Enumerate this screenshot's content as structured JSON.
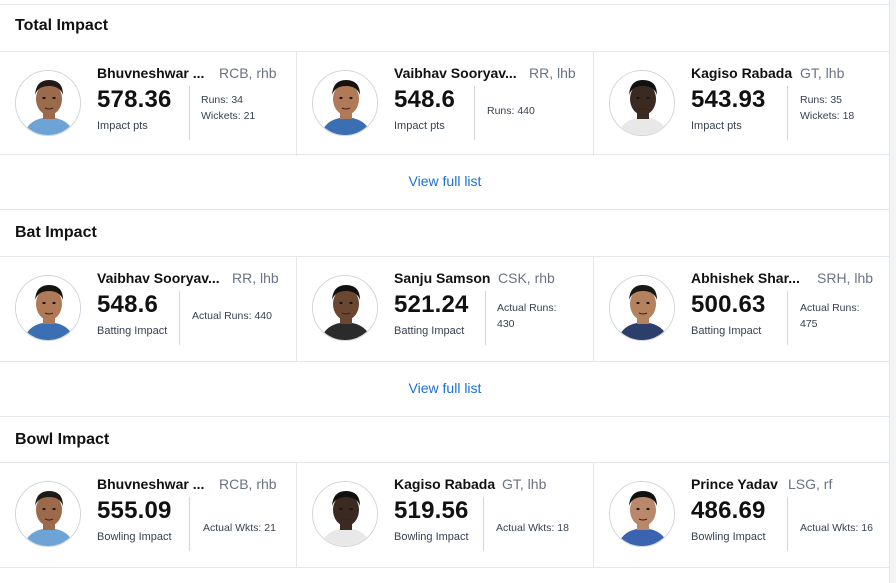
{
  "sections": [
    {
      "title": "Total Impact",
      "view_label": "View full list",
      "cards": [
        {
          "name": "Bhuvneshwar ...",
          "team": "RCB, rhb",
          "score": "578.36",
          "label": "Impact pts",
          "stats": [
            "Runs: 34",
            "Wickets: 21"
          ],
          "skin": "#9a6a4a",
          "hair": "#1f1a17",
          "jersey": "#6ea3d6"
        },
        {
          "name": "Vaibhav Sooryav...",
          "team": "RR, lhb",
          "score": "548.6",
          "label": "Impact pts",
          "stats": [
            "Runs: 440"
          ],
          "skin": "#b07a58",
          "hair": "#16130f",
          "jersey": "#3a6fb3"
        },
        {
          "name": "Kagiso Rabada",
          "team": "GT, lhb",
          "score": "543.93",
          "label": "Impact pts",
          "stats": [
            "Runs: 35",
            "Wickets: 18"
          ],
          "skin": "#3b2a22",
          "hair": "#111111",
          "jersey": "#e8e8e8"
        }
      ]
    },
    {
      "title": "Bat Impact",
      "view_label": "View full list",
      "cards": [
        {
          "name": "Vaibhav Sooryav...",
          "team": "RR, lhb",
          "score": "548.6",
          "label": "Batting Impact",
          "stats": [
            "Actual Runs: 440"
          ],
          "skin": "#b07a58",
          "hair": "#16130f",
          "jersey": "#3a6fb3"
        },
        {
          "name": "Sanju Samson",
          "team": "CSK, rhb",
          "score": "521.24",
          "label": "Batting Impact",
          "stats": [
            "Actual Runs:",
            "430"
          ],
          "skin": "#6b4630",
          "hair": "#121010",
          "jersey": "#2b2b2b"
        },
        {
          "name": "Abhishek Shar...",
          "team": "SRH, lhb",
          "score": "500.63",
          "label": "Batting Impact",
          "stats": [
            "Actual Runs:",
            "475"
          ],
          "skin": "#b58260",
          "hair": "#1a1714",
          "jersey": "#2c3e6a"
        }
      ]
    },
    {
      "title": "Bowl Impact",
      "cards": [
        {
          "name": "Bhuvneshwar ...",
          "team": "RCB, rhb",
          "score": "555.09",
          "label": "Bowling Impact",
          "stats": [
            "Actual Wkts: 21"
          ],
          "skin": "#9a6a4a",
          "hair": "#1f1a17",
          "jersey": "#6ea3d6"
        },
        {
          "name": "Kagiso Rabada",
          "team": "GT, lhb",
          "score": "519.56",
          "label": "Bowling Impact",
          "stats": [
            "Actual Wkts: 18"
          ],
          "skin": "#3b2a22",
          "hair": "#111111",
          "jersey": "#e8e8e8"
        },
        {
          "name": "Prince Yadav",
          "team": "LSG, rf",
          "score": "486.69",
          "label": "Bowling Impact",
          "stats": [
            "Actual Wkts: 16"
          ],
          "skin": "#b9876a",
          "hair": "#141210",
          "jersey": "#3a64b0"
        }
      ]
    }
  ]
}
